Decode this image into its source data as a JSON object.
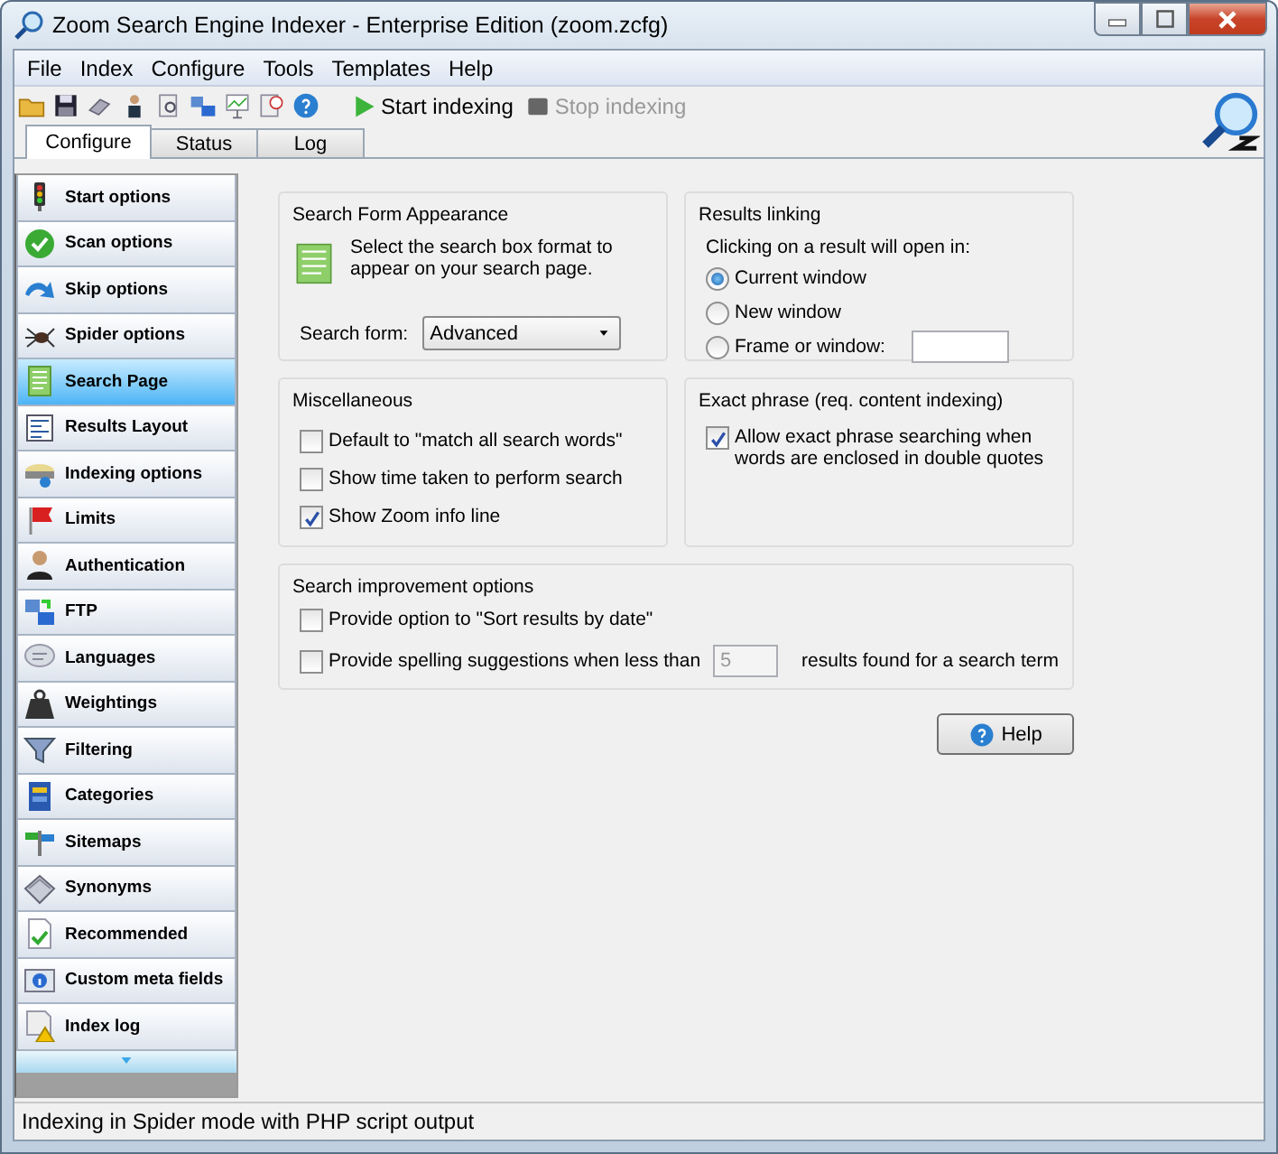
{
  "window": {
    "title": "Zoom Search Engine Indexer - Enterprise Edition (zoom.zcfg)"
  },
  "menu": [
    "File",
    "Index",
    "Configure",
    "Tools",
    "Templates",
    "Help"
  ],
  "toolbar": {
    "actions": [
      {
        "label": "Start indexing",
        "disabled": false
      },
      {
        "label": "Stop indexing",
        "disabled": true
      }
    ]
  },
  "tabs": [
    {
      "label": "Configure",
      "selected": true
    },
    {
      "label": "Status",
      "selected": false
    },
    {
      "label": "Log",
      "selected": false
    }
  ],
  "sidebar": {
    "items": [
      {
        "label": "Start options",
        "selected": false
      },
      {
        "label": "Scan options",
        "selected": false
      },
      {
        "label": "Skip options",
        "selected": false
      },
      {
        "label": "Spider options",
        "selected": false
      },
      {
        "label": "Search Page",
        "selected": true
      },
      {
        "label": "Results Layout",
        "selected": false
      },
      {
        "label": "Indexing options",
        "selected": false
      },
      {
        "label": "Limits",
        "selected": false
      },
      {
        "label": "Authentication",
        "selected": false
      },
      {
        "label": "FTP",
        "selected": false
      },
      {
        "label": "Languages",
        "selected": false
      },
      {
        "label": "Weightings",
        "selected": false
      },
      {
        "label": "Filtering",
        "selected": false
      },
      {
        "label": "Categories",
        "selected": false
      },
      {
        "label": "Sitemaps",
        "selected": false
      },
      {
        "label": "Synonyms",
        "selected": false
      },
      {
        "label": "Recommended",
        "selected": false
      },
      {
        "label": "Custom meta fields",
        "selected": false
      },
      {
        "label": "Index log",
        "selected": false
      }
    ]
  },
  "search_form_appearance": {
    "title": "Search Form Appearance",
    "description": "Select the search box format to appear on your search page.",
    "field_label": "Search form:",
    "value": "Advanced"
  },
  "results_linking": {
    "title": "Results linking",
    "prompt": "Clicking on a result will open in:",
    "options": [
      {
        "label": "Current window",
        "selected": true
      },
      {
        "label": "New window",
        "selected": false
      },
      {
        "label": "Frame or window:",
        "selected": false
      }
    ]
  },
  "miscellaneous": {
    "title": "Miscellaneous",
    "options": [
      {
        "label": "Default to \"match all search words\"",
        "checked": false
      },
      {
        "label": "Show time taken to perform search",
        "checked": false
      },
      {
        "label": "Show Zoom info line",
        "checked": true
      }
    ]
  },
  "exact_phrase": {
    "title": "Exact phrase (req. content indexing)",
    "options": [
      {
        "label": "Allow exact phrase searching when words are enclosed in double quotes",
        "checked": true
      }
    ]
  },
  "search_improvement": {
    "title": "Search improvement options",
    "sort": {
      "label": "Provide option to \"Sort results by date\"",
      "checked": false
    },
    "spelling": {
      "label": "Provide spelling suggestions when less than",
      "value": "5",
      "disabled": true,
      "suffix": "results found for a search term",
      "checked": false
    }
  },
  "help_button": "Help",
  "status_bar": "Indexing in Spider mode with PHP script output"
}
